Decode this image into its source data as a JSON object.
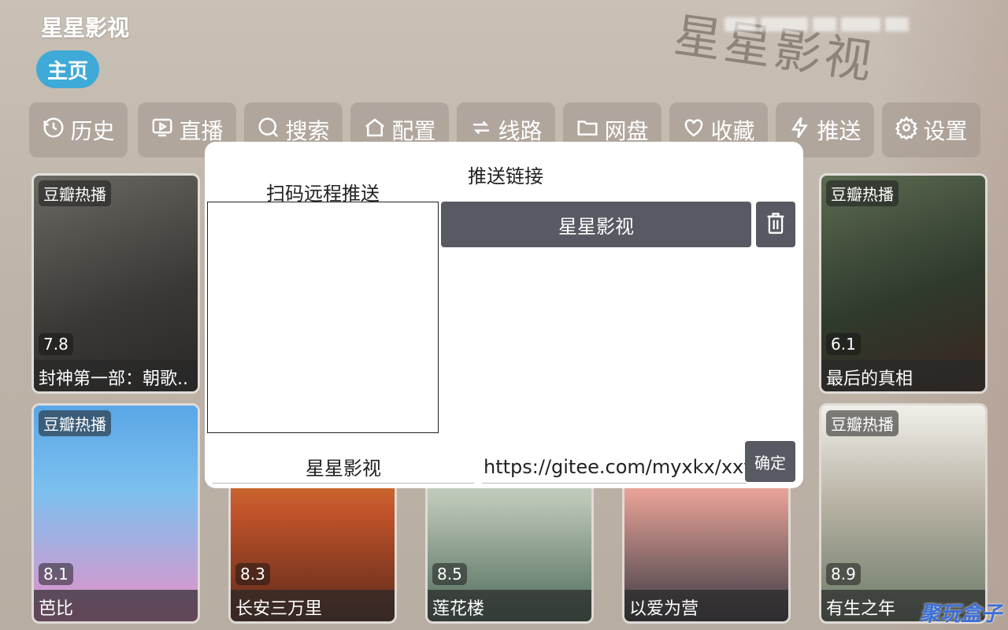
{
  "app": {
    "title": "星星影视"
  },
  "nav": {
    "home_tab": "主页"
  },
  "background": {
    "calligraphy": "星星影视"
  },
  "toolbar": {
    "items": [
      {
        "label": "历史",
        "icon": "history-icon"
      },
      {
        "label": "直播",
        "icon": "tv-icon"
      },
      {
        "label": "搜索",
        "icon": "search-icon"
      },
      {
        "label": "配置",
        "icon": "home-config-icon"
      },
      {
        "label": "线路",
        "icon": "route-icon"
      },
      {
        "label": "网盘",
        "icon": "folder-icon"
      },
      {
        "label": "收藏",
        "icon": "heart-icon"
      },
      {
        "label": "推送",
        "icon": "bolt-icon"
      },
      {
        "label": "设置",
        "icon": "gear-icon"
      }
    ]
  },
  "cards": [
    {
      "badge": "豆瓣热播",
      "score": "7.8",
      "title": "封神第一部：朝歌..",
      "color": "#4b4a47"
    },
    {
      "badge": "豆瓣热播",
      "score": "6.1",
      "title": "最后的真相",
      "color": "#3e4a3a"
    },
    {
      "badge": "豆瓣热播",
      "score": "8.1",
      "title": "芭比",
      "color": "#5aa6e6"
    },
    {
      "badge": "",
      "score": "8.3",
      "title": "长安三万里",
      "color": "#c0522a"
    },
    {
      "badge": "",
      "score": "8.5",
      "title": "莲花楼",
      "color": "#8fa08c"
    },
    {
      "badge": "",
      "score": "",
      "title": "以爱为营",
      "color": "#d98a7a"
    },
    {
      "badge": "豆瓣热播",
      "score": "8.9",
      "title": "有生之年",
      "color": "#7d8f7a"
    }
  ],
  "dialog": {
    "title": "推送链接",
    "qr_label": "扫码远程推送",
    "source_button": "星星影视",
    "name_value": "星星影视",
    "url_value": "https://gitee.com/myxkx/xxys",
    "confirm": "确定",
    "delete_icon": "trash-icon"
  },
  "watermark": {
    "text": "聚玩盒子"
  }
}
